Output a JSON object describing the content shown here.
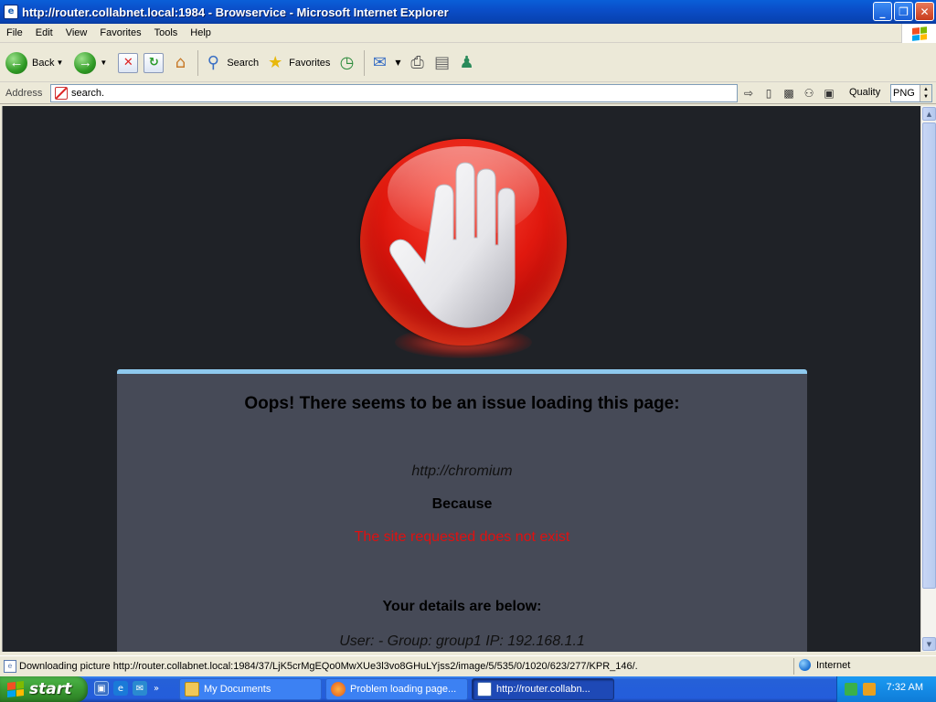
{
  "window": {
    "title": "http://router.collabnet.local:1984 - Browservice - Microsoft Internet Explorer",
    "buttons": {
      "minimize": "_",
      "maximize": "❐",
      "close": "✕"
    }
  },
  "menu": [
    "File",
    "Edit",
    "View",
    "Favorites",
    "Tools",
    "Help"
  ],
  "toolbar": {
    "back_label": "Back",
    "search_label": "Search",
    "favorites_label": "Favorites"
  },
  "address": {
    "label": "Address",
    "value": "search.",
    "quality_label": "Quality",
    "quality_value": "PNG"
  },
  "page": {
    "heading": "Oops! There seems to be an issue loading this page:",
    "url": "http://chromium",
    "because": "Because",
    "reason": "The site requested does not exist",
    "details_heading": "Your details are below:",
    "details": "User: -   Group: group1   IP: 192.168.1.1"
  },
  "status": {
    "text": "Downloading picture http://router.collabnet.local:1984/37/LjK5crMgEQo0MwXUe3l3vo8GHuLYjss2/image/5/535/0/1020/623/277/KPR_146/.",
    "zone": "Internet"
  },
  "taskbar": {
    "start_label": "start",
    "tasks": [
      {
        "label": "My Documents"
      },
      {
        "label": "Problem loading page..."
      },
      {
        "label": "http://router.collabn..."
      }
    ],
    "clock": "7:32 AM"
  },
  "colors": {
    "title_bar": "#0a4ec9",
    "page_background": "#1f2227",
    "panel_background": "#464a57",
    "panel_accent": "#8ec9ee",
    "error_red": "#e01010",
    "taskbar": "#245ddb",
    "start_green": "#3a9a32"
  }
}
